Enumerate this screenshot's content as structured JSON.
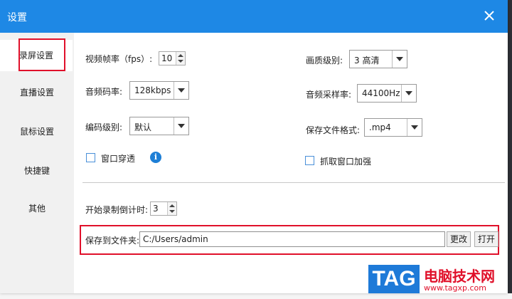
{
  "dialog": {
    "title": "设置"
  },
  "sidebar": {
    "items": [
      {
        "label": "录屏设置"
      },
      {
        "label": "直播设置"
      },
      {
        "label": "鼠标设置"
      },
      {
        "label": "快捷键"
      },
      {
        "label": "其他"
      }
    ],
    "active_index": 0
  },
  "settings": {
    "fps": {
      "label": "视频帧率（fps）:",
      "value": "10"
    },
    "quality": {
      "label": "画质级别:",
      "value": "3 高清"
    },
    "video_bitrate": {
      "label": "音频码率:",
      "value": "128kbps"
    },
    "audio_sample_rate": {
      "label": "音频采样率:",
      "value": "44100Hz"
    },
    "encode_level": {
      "label": "编码级别:",
      "value": "默认"
    },
    "file_format": {
      "label": "保存文件格式:",
      "value": ".mp4"
    },
    "window_transparent": {
      "label": "窗口穿透",
      "checked": false
    },
    "capture_window_enhance": {
      "label": "抓取窗口加强",
      "checked": false
    },
    "countdown": {
      "label": "开始录制倒计时:",
      "value": "3"
    },
    "save_folder": {
      "label": "保存到文件夹:",
      "value": "C:/Users/admin",
      "change_label": "更改",
      "open_label": "打开"
    }
  },
  "watermark": {
    "logo": "TAG",
    "site_name": "电脑技术网",
    "url": "www.tagxp.com"
  },
  "colors": {
    "titlebar": "#1e88e5",
    "highlight": "#e0102a",
    "info": "#1e7fd6"
  }
}
